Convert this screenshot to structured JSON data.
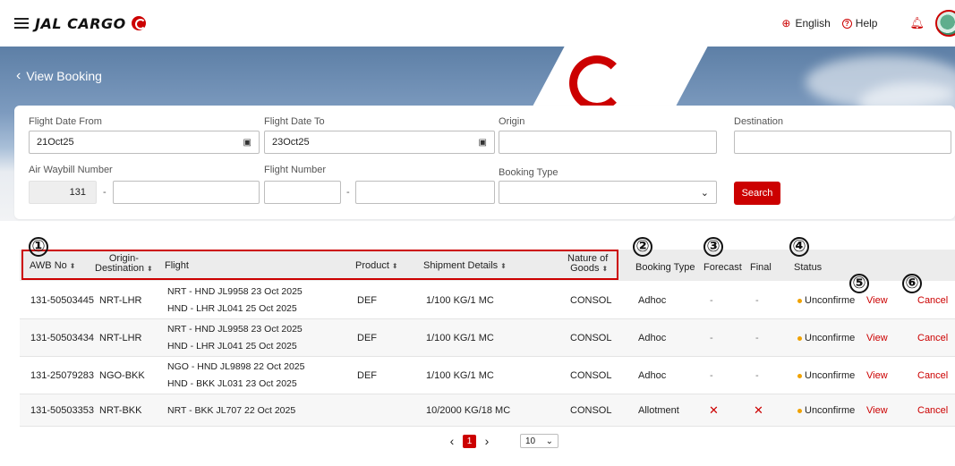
{
  "header": {
    "brand": "JAL CARGO",
    "language": "English",
    "help": "Help"
  },
  "hero": {
    "back_label": "View Booking"
  },
  "filters": {
    "flight_date_from": {
      "label": "Flight Date From",
      "value": "21Oct25"
    },
    "flight_date_to": {
      "label": "Flight Date To",
      "value": "23Oct25"
    },
    "origin": {
      "label": "Origin",
      "value": ""
    },
    "destination": {
      "label": "Destination",
      "value": ""
    },
    "awb": {
      "label": "Air Waybill Number",
      "prefix": "131",
      "value": ""
    },
    "flight_number": {
      "label": "Flight Number",
      "carrier": "",
      "number": ""
    },
    "booking_type": {
      "label": "Booking Type",
      "value": ""
    },
    "search_label": "Search"
  },
  "annotations": [
    "①",
    "②",
    "③",
    "④",
    "⑤",
    "⑥"
  ],
  "table": {
    "headers": {
      "awb": "AWB No",
      "origin_dest_1": "Origin-",
      "origin_dest_2": "Destination",
      "flight": "Flight",
      "product": "Product",
      "shipment": "Shipment Details",
      "nature_1": "Nature of",
      "nature_2": "Goods",
      "booking_type": "Booking Type",
      "forecast": "Forecast",
      "final": "Final",
      "status": "Status"
    },
    "rows": [
      {
        "awb": "131-50503445",
        "od": "NRT-LHR",
        "flight1": "NRT - HND JL9958 23 Oct 2025",
        "flight2": "HND - LHR JL041 25 Oct 2025",
        "product": "DEF",
        "shipment": "1/100 KG/1 MC",
        "nature": "CONSOL",
        "booking_type": "Adhoc",
        "forecast": "-",
        "final": "-",
        "status": "Unconfirme",
        "view": "View",
        "cancel": "Cancel"
      },
      {
        "awb": "131-50503434",
        "od": "NRT-LHR",
        "flight1": "NRT - HND JL9958 23 Oct 2025",
        "flight2": "HND - LHR JL041 25 Oct 2025",
        "product": "DEF",
        "shipment": "1/100 KG/1 MC",
        "nature": "CONSOL",
        "booking_type": "Adhoc",
        "forecast": "-",
        "final": "-",
        "status": "Unconfirme",
        "view": "View",
        "cancel": "Cancel"
      },
      {
        "awb": "131-25079283",
        "od": "NGO-BKK",
        "flight1": "NGO - HND JL9898 22 Oct 2025",
        "flight2": "HND - BKK JL031 23 Oct 2025",
        "product": "DEF",
        "shipment": "1/100 KG/1 MC",
        "nature": "CONSOL",
        "booking_type": "Adhoc",
        "forecast": "-",
        "final": "-",
        "status": "Unconfirme",
        "view": "View",
        "cancel": "Cancel"
      },
      {
        "awb": "131-50503353",
        "od": "NRT-BKK",
        "flight1": "NRT - BKK JL707 22 Oct 2025",
        "flight2": "",
        "product": "",
        "shipment": "10/2000 KG/18 MC",
        "nature": "CONSOL",
        "booking_type": "Allotment",
        "forecast": "✕",
        "final": "✕",
        "status": "Unconfirme",
        "view": "View",
        "cancel": "Cancel"
      }
    ]
  },
  "pagination": {
    "current_page": "1",
    "page_size": "10"
  }
}
